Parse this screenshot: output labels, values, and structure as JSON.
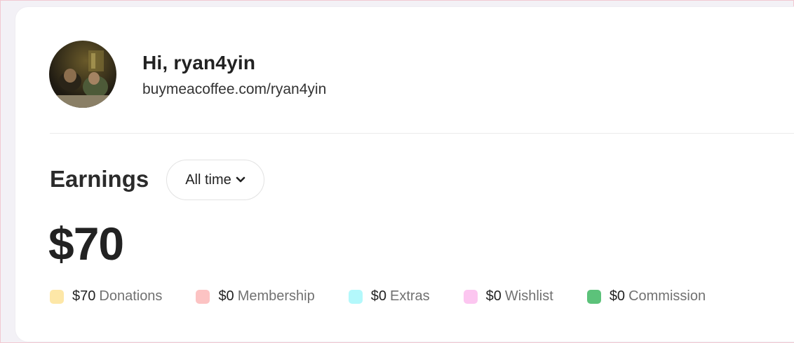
{
  "profile": {
    "greeting": "Hi, ryan4yin",
    "page_url": "buymeacoffee.com/ryan4yin"
  },
  "earnings": {
    "title": "Earnings",
    "period": "All time",
    "total": "$70",
    "breakdown": [
      {
        "amount": "$70",
        "label": "Donations",
        "color": "#fde7a7"
      },
      {
        "amount": "$0",
        "label": "Membership",
        "color": "#fcc3c3"
      },
      {
        "amount": "$0",
        "label": "Extras",
        "color": "#b3f8fb"
      },
      {
        "amount": "$0",
        "label": "Wishlist",
        "color": "#fcc6f0"
      },
      {
        "amount": "$0",
        "label": "Commission",
        "color": "#5cc27a"
      }
    ]
  },
  "icons": {
    "period_dropdown": "chevron-down-icon",
    "profile_picture": "avatar"
  }
}
